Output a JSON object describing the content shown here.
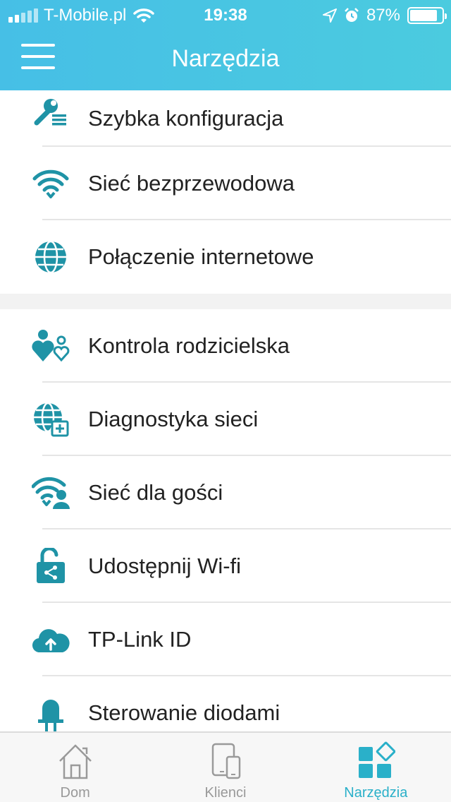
{
  "status": {
    "carrier": "T-Mobile.pl",
    "time": "19:38",
    "battery": "87%",
    "battery_level": 0.87
  },
  "header": {
    "title": "Narzędzia"
  },
  "sections": [
    {
      "items": [
        {
          "label": "Szybka konfiguracja",
          "icon": "quick-setup-icon"
        },
        {
          "label": "Sieć bezprzewodowa",
          "icon": "wifi-icon"
        },
        {
          "label": "Połączenie internetowe",
          "icon": "globe-icon"
        }
      ]
    },
    {
      "items": [
        {
          "label": "Kontrola rodzicielska",
          "icon": "parental-control-icon"
        },
        {
          "label": "Diagnostyka sieci",
          "icon": "network-diagnostics-icon"
        },
        {
          "label": "Sieć dla gości",
          "icon": "guest-network-icon"
        },
        {
          "label": "Udostępnij Wi-fi",
          "icon": "share-wifi-icon"
        },
        {
          "label": "TP-Link ID",
          "icon": "cloud-upload-icon"
        },
        {
          "label": "Sterowanie diodami",
          "icon": "led-icon"
        }
      ]
    }
  ],
  "tabs": [
    {
      "label": "Dom",
      "icon": "home-icon",
      "active": false
    },
    {
      "label": "Klienci",
      "icon": "devices-icon",
      "active": false
    },
    {
      "label": "Narzędzia",
      "icon": "tools-grid-icon",
      "active": true
    }
  ],
  "colors": {
    "accent": "#2ab0c9",
    "icon": "#1f93a6",
    "header_start": "#46bfe6",
    "header_end": "#4bcbdf"
  }
}
